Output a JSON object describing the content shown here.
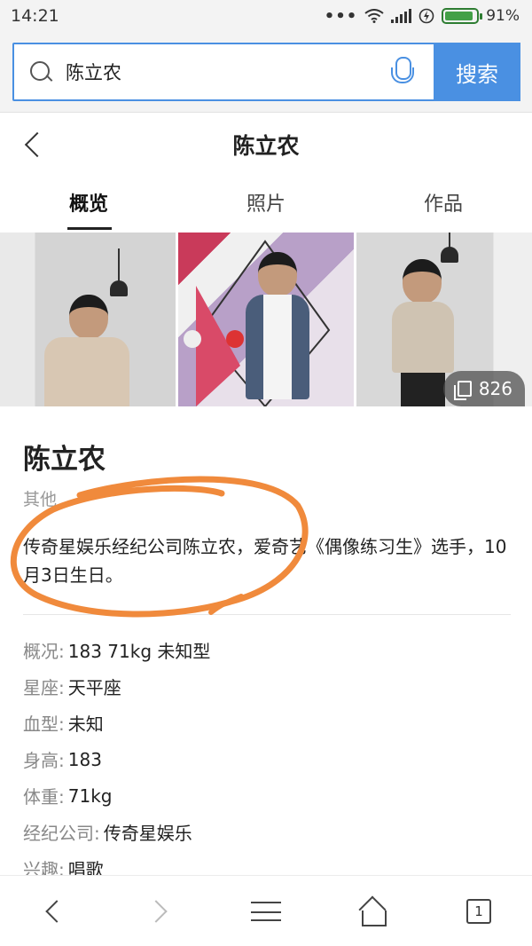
{
  "status_bar": {
    "time": "14:21",
    "dots": "•••",
    "battery_text": "91%",
    "battery_level": 0.91
  },
  "search": {
    "query": "陈立农",
    "button_label": "搜索"
  },
  "header": {
    "title": "陈立农"
  },
  "tabs": [
    {
      "label": "概览",
      "active": true
    },
    {
      "label": "照片",
      "active": false
    },
    {
      "label": "作品",
      "active": false
    }
  ],
  "photos": {
    "count": "826"
  },
  "profile": {
    "name": "陈立农",
    "category": "其他",
    "description": "传奇星娱乐经纪公司陈立农，爱奇艺《偶像练习生》选手，10月3日生日。"
  },
  "facts": [
    {
      "key": "概况: ",
      "value": "183 71kg 未知型"
    },
    {
      "key": "星座: ",
      "value": "天平座"
    },
    {
      "key": "血型: ",
      "value": "未知"
    },
    {
      "key": "身高: ",
      "value": "183"
    },
    {
      "key": "体重: ",
      "value": "71kg"
    },
    {
      "key": "经纪公司: ",
      "value": "传奇星娱乐"
    },
    {
      "key": "兴趣: ",
      "value": "唱歌"
    }
  ],
  "bottom_nav": {
    "tab_count": "1"
  },
  "colors": {
    "accent": "#4a90e2",
    "annotation": "#f08a3c",
    "battery": "#43a047"
  }
}
